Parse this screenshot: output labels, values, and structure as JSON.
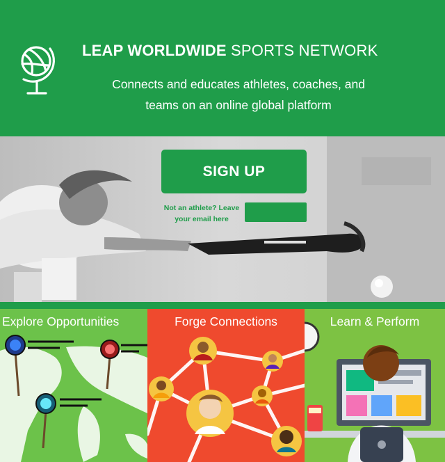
{
  "header": {
    "brand_bold": "LEAP WORLDWIDE",
    "brand_light": " SPORTS NETWORK",
    "subtitle": "Connects and educates athletes, coaches, and teams on an online global platform"
  },
  "hero": {
    "signup_label": "SIGN UP",
    "email_note": "Not an athlete? Leave your email here",
    "email_placeholder": ""
  },
  "tiles": [
    {
      "label": "Explore Opportunities"
    },
    {
      "label": "Forge Connections"
    },
    {
      "label": "Learn & Perform"
    }
  ],
  "colors": {
    "brand_green": "#1f9d4a",
    "tile_green": "#6cc24a",
    "tile_orange": "#ef4a2e",
    "tile_lime": "#7dc243"
  },
  "icons": [
    "globe-icon",
    "map-pin-icon",
    "avatar-icon",
    "monitor-icon"
  ]
}
